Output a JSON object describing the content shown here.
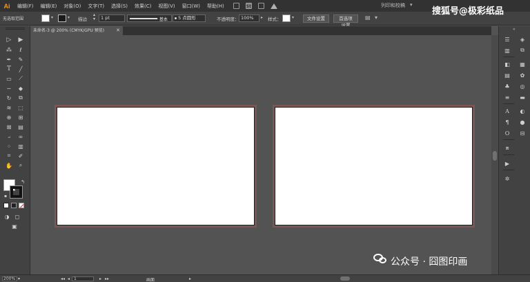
{
  "app": {
    "logo": "Ai"
  },
  "menubar": {
    "items": [
      "编辑(F)",
      "编辑(E)",
      "对象(O)",
      "文字(T)",
      "选择(S)",
      "效果(C)",
      "视图(V)",
      "窗口(W)",
      "帮助(H)"
    ],
    "stock_label": "St",
    "workspace": "列印和校稿",
    "workspace_chevron": "▾"
  },
  "controlbar": {
    "selection": "无选取范围",
    "stroke_label": "描边",
    "stroke_weight": "1 pt",
    "stroke_style": "一 基本",
    "brush_label": "5 点圆形",
    "opacity_label": "不透明度：",
    "opacity_value": "100%",
    "style_label": "样式：",
    "doc_setup_button": "文件设置",
    "prefs_button": "首选项设置"
  },
  "tab": {
    "title": "未命名-3 @ 200% (CMYK/GPU 预览)",
    "close": "✕"
  },
  "statusbar": {
    "zoom": "200%",
    "artboard_num": "1",
    "status_text": "画面",
    "first": "◂◂",
    "prev": "◂",
    "next": "▸",
    "last": "▸▸",
    "chevron": "▾"
  },
  "watermarks": {
    "top_right": "搜狐号@极彩纸品",
    "bottom_right": "公众号 · 囧图印画"
  },
  "colors": {
    "menubar_bg": "#323232",
    "panel_bg": "#424242",
    "canvas_bg": "#535353",
    "artboard": "#ffffff",
    "logo": "#ff9a00",
    "bleed": "#7a5656"
  },
  "tools_left": [
    "selection-tool",
    "direct-selection-tool",
    "magic-wand-tool",
    "lasso-tool",
    "pen-tool",
    "curvature-tool",
    "type-tool",
    "line-segment-tool",
    "rectangle-tool",
    "paintbrush-tool",
    "shaper-tool",
    "eraser-tool",
    "rotate-tool",
    "scale-tool",
    "width-tool",
    "free-transform-tool",
    "shape-builder-tool",
    "perspective-grid-tool",
    "mesh-tool",
    "gradient-tool",
    "eyedropper-tool",
    "blend-tool",
    "symbol-sprayer-tool",
    "graph-tool",
    "artboard-tool",
    "slice-tool",
    "hand-tool",
    "zoom-tool"
  ],
  "dock_icons": [
    "libraries-icon",
    "layers-icon",
    "properties-icon",
    "color-icon",
    "color-guide-icon",
    "swatches-icon",
    "brushes-icon",
    "symbols-icon",
    "stroke-icon",
    "gradient-icon",
    "transparency-icon",
    "character-icon",
    "paragraph-icon",
    "opentype-icon",
    "align-icon",
    "actions-icon",
    "settings-icon"
  ]
}
